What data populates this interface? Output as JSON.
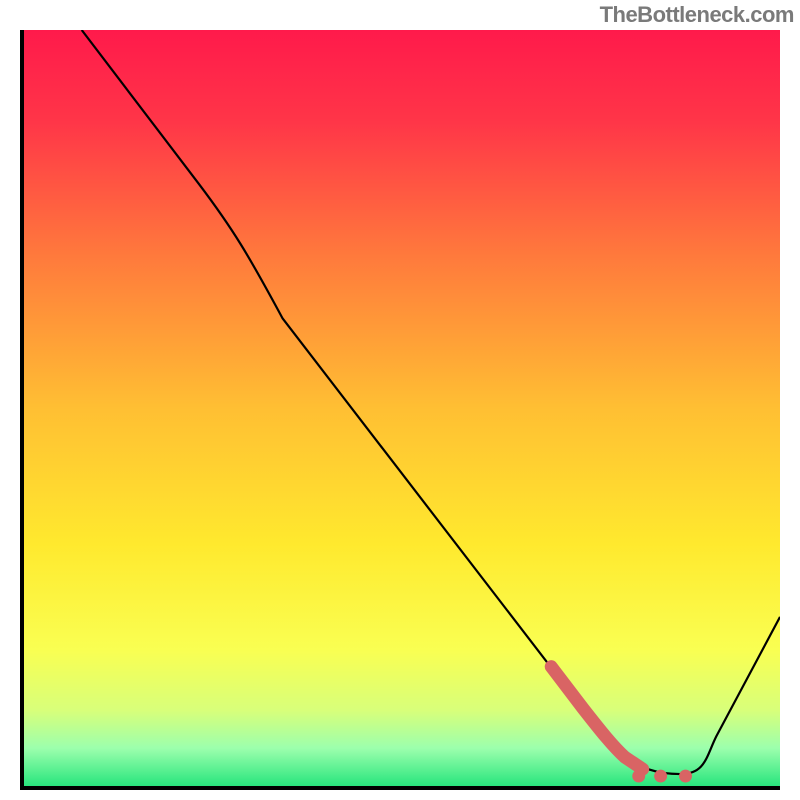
{
  "watermark": "TheBottleneck.com",
  "chart_data": {
    "type": "line",
    "title": "",
    "xlabel": "",
    "ylabel": "",
    "xlim": [
      0,
      100
    ],
    "ylim": [
      0,
      100
    ],
    "grid": false,
    "legend": false,
    "background_gradient": {
      "orientation": "vertical",
      "stops": [
        {
          "pos": 0.0,
          "color": "#ff1a4b"
        },
        {
          "pos": 0.3,
          "color": "#ff7a3c"
        },
        {
          "pos": 0.6,
          "color": "#ffe92e"
        },
        {
          "pos": 0.9,
          "color": "#d8ff7a"
        },
        {
          "pos": 1.0,
          "color": "#28e57d"
        }
      ]
    },
    "series": [
      {
        "name": "bottleneck_curve",
        "color": "#000000",
        "stroke_width": 2,
        "x": [
          8,
          23,
          34,
          45,
          56,
          63,
          70,
          74,
          79,
          82,
          85,
          88,
          92,
          100
        ],
        "y": [
          100,
          80,
          62,
          46,
          30,
          21,
          13,
          8,
          4,
          2,
          1,
          2,
          6,
          22
        ]
      },
      {
        "name": "highlight_segment",
        "color": "#d96464",
        "stroke_width": 13,
        "x": [
          70,
          74,
          79,
          82
        ],
        "y": [
          16,
          10,
          4,
          2
        ]
      }
    ],
    "markers": [
      {
        "name": "highlight-dot",
        "x": 81,
        "y": 1,
        "r": 6.5,
        "color": "#d96464"
      },
      {
        "name": "highlight-dot",
        "x": 84,
        "y": 1,
        "r": 6.5,
        "color": "#d96464"
      },
      {
        "name": "highlight-dot",
        "x": 87,
        "y": 1,
        "r": 6.5,
        "color": "#d96464"
      }
    ]
  }
}
